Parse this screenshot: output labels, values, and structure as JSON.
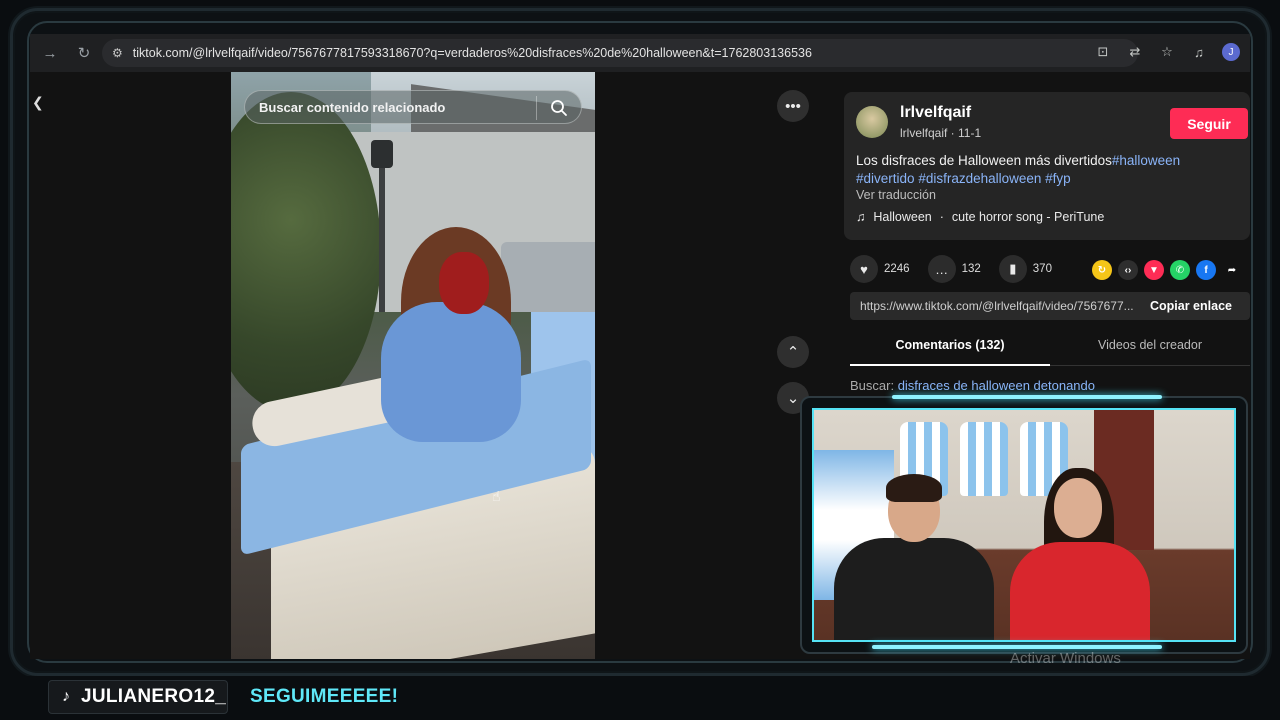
{
  "browser": {
    "url": "tiktok.com/@lrlvelfqaif/video/7567677817593318670?q=verdaderos%20disfraces%20de%20halloween&t=1762803136536",
    "profile_initial": "J"
  },
  "video": {
    "search_placeholder": "Buscar contenido relacionado"
  },
  "creator": {
    "name": "lrlvelfqaif",
    "handle_line": "lrlvelfqaif · 11-1",
    "follow_label": "Seguir"
  },
  "post": {
    "description_text": "Los disfraces de Halloween más divertidos",
    "tags": [
      "#halloween",
      "#divertido",
      "#disfrazdehalloween",
      "#fyp"
    ],
    "translate_label": "Ver traducción",
    "music_title": "Halloween",
    "music_sep": "·",
    "music_artist": "cute horror song - PeriTune"
  },
  "actions": {
    "likes": "2246",
    "comments": "132",
    "saves": "370"
  },
  "link": {
    "url": "https://www.tiktok.com/@lrlvelfqaif/video/7567677...",
    "copy_label": "Copiar enlace"
  },
  "tabs": {
    "comments": "Comentarios (132)",
    "creator_videos": "Videos del creador"
  },
  "search_suggestion": {
    "prefix": "Buscar: ",
    "query": "disfraces de halloween detonando"
  },
  "watermark": "Activar Windows",
  "overlay": {
    "handle": "JULIANERO12_",
    "cta": "SEGUIMEEEEE!"
  },
  "colors": {
    "follow": "#fe2c55",
    "tag": "#8ab4f8",
    "cta": "#5fe8f8"
  }
}
